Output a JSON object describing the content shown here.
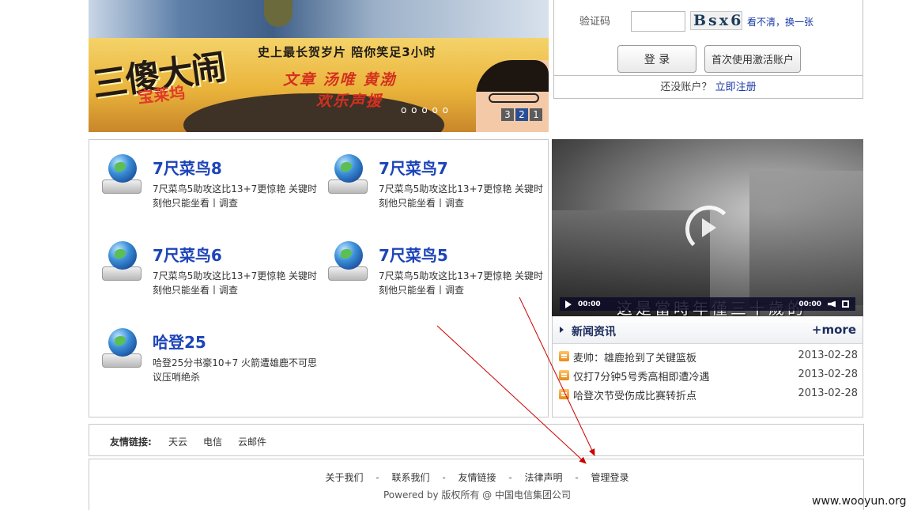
{
  "banner": {
    "logo_main": "三傻大闹",
    "logo_sub": "宝莱坞",
    "slogan": "史上最长贺岁片  陪你笑足3小时",
    "stars_line1": "文章  汤唯  黄渤",
    "stars_line2": "欢乐声援",
    "bubbles": "o o o o o",
    "slides": [
      "3",
      "2",
      "1"
    ],
    "active_slide": "2"
  },
  "login": {
    "captcha_label": "验证码",
    "captcha_value": "",
    "captcha_text": "Bsx6",
    "refresh_link": "看不清，换一张",
    "login_button": "登 录",
    "activate_button": "首次使用激活账户",
    "no_account_text": "还没账户？",
    "register_link": "立即注册"
  },
  "news_grid": [
    {
      "title": "7尺菜鸟8",
      "desc": "7尺菜鸟5助攻这比13+7更惊艳 关键时刻他只能坐看丨调查"
    },
    {
      "title": "7尺菜鸟7",
      "desc": "7尺菜鸟5助攻这比13+7更惊艳 关键时刻他只能坐看丨调查"
    },
    {
      "title": "7尺菜鸟6",
      "desc": "7尺菜鸟5助攻这比13+7更惊艳 关键时刻他只能坐看丨调查"
    },
    {
      "title": "7尺菜鸟5",
      "desc": "7尺菜鸟5助攻这比13+7更惊艳 关键时刻他只能坐看丨调查"
    },
    {
      "title": "哈登25",
      "desc": "哈登25分书豪10+7 火箭遭雄鹿不可思议压哨绝杀"
    }
  ],
  "video": {
    "subtitle": "这是當時年僅三十歲的",
    "time_current": "00:00",
    "time_total": "00:00"
  },
  "news_list": {
    "title": "新闻资讯",
    "more": "+more",
    "items": [
      {
        "headline": "麦帅：雄鹿抢到了关键篮板",
        "date": "2013-02-28"
      },
      {
        "headline": "仅打7分钟5号秀高相即遭冷遇",
        "date": "2013-02-28"
      },
      {
        "headline": "哈登次节受伤成比赛转折点",
        "date": "2013-02-28"
      }
    ]
  },
  "friends": {
    "label": "友情链接:",
    "links": [
      "天云",
      "电信",
      "云邮件"
    ]
  },
  "footer": {
    "nav": [
      "关于我们",
      "联系我们",
      "友情链接",
      "法律声明",
      "管理登录"
    ],
    "separator": "-",
    "copyright": "Powered by 版权所有 @ 中国电信集团公司"
  },
  "watermark": "www.wooyun.org",
  "colors": {
    "link_blue": "#1d44b8",
    "nav_navy": "#1c2e5e",
    "bullet_orange": "#e98a18",
    "annotation_red": "#cc0000"
  }
}
